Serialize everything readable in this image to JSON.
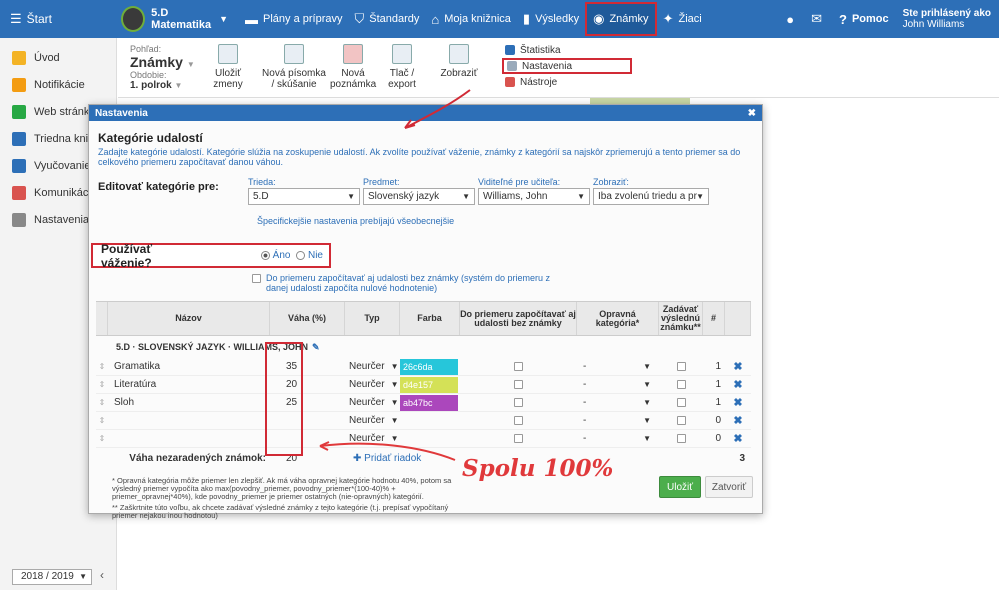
{
  "topbar": {
    "start": "Štart",
    "class_name": "5.D",
    "class_subject": "Matematika",
    "plans": "Plány a prípravy",
    "standards": "Štandardy",
    "library": "Moja knižnica",
    "results": "Výsledky",
    "grades": "Známky",
    "students": "Žiaci",
    "help": "Pomoc",
    "user_prefix": "Ste prihlásený ako",
    "user_name": "John Williams"
  },
  "sidebar": {
    "items": [
      {
        "label": "Úvod",
        "color": "#f3b325"
      },
      {
        "label": "Notifikácie",
        "color": "#f39c12"
      },
      {
        "label": "Web stránka",
        "color": "#27a844"
      },
      {
        "label": "Triedna kniha",
        "color": "#2d6fb7"
      },
      {
        "label": "Vyučovanie",
        "color": "#2d6fb7"
      },
      {
        "label": "Komunikácia",
        "color": "#d9534f"
      },
      {
        "label": "Nastavenia",
        "color": "#888888"
      }
    ],
    "year": "2018 / 2019"
  },
  "ribbon": {
    "view_label": "Pohľad:",
    "view_value": "Známky",
    "period_label": "Obdobie:",
    "period_value": "1. polrok",
    "save_changes": "Uložiť zmeny",
    "new_test": "Nová písomka / skúšanie",
    "new_note": "Nová poznámka",
    "print": "Tlač / export",
    "show": "Zobraziť",
    "menu_stats": "Štatistika",
    "menu_settings": "Nastavenia",
    "menu_tools": "Nástroje"
  },
  "modal": {
    "title": "Nastavenia",
    "section_title": "Kategórie udalostí",
    "section_desc": "Zadajte kategórie udalostí. Kategórie slúžia na zoskupenie udalostí. Ak zvolíte používať váženie, známky z kategórií sa najskôr zpriemerujú a tento priemer sa do celkového priemeru započítavať danou váhou.",
    "edit_label": "Editovať kategórie pre:",
    "filters": {
      "class_label": "Trieda:",
      "class_value": "5.D",
      "subject_label": "Predmet:",
      "subject_value": "Slovenský jazyk",
      "teacher_label": "Viditeľné pre učiteľa:",
      "teacher_value": "Williams, John",
      "show_label": "Zobraziť:",
      "show_value": "Iba zvolenú triedu a pr",
      "note": "Špecifickejšie nastavenia prebíjajú všeobecnejšie"
    },
    "weighting_question": "Používať váženie?",
    "opt_yes": "Áno",
    "opt_no": "Nie",
    "include_ungraded": "Do priemeru započítavať aj udalosti bez známky (systém do priemeru z danej udalosti započíta nulové hodnotenie)",
    "table": {
      "headers": {
        "name": "Názov",
        "weight": "Váha (%)",
        "type": "Typ",
        "color": "Farba",
        "include": "Do priemeru započítavať aj udalosti bez známky",
        "corrective": "Opravná kategória*",
        "final": "Zadávať výslednú známku**",
        "count": "#"
      },
      "group": "5.D · SLOVENSKÝ JAZYK · WILLIAMS, JOHN",
      "rows": [
        {
          "name": "Gramatika",
          "weight": "35",
          "type": "Neurčer",
          "color_code": "26c6da",
          "color": "#26c6da",
          "corrective": "-",
          "count": "1"
        },
        {
          "name": "Literatúra",
          "weight": "20",
          "type": "Neurčer",
          "color_code": "d4e157",
          "color": "#d4e157",
          "corrective": "-",
          "count": "1"
        },
        {
          "name": "Sloh",
          "weight": "25",
          "type": "Neurčer",
          "color_code": "ab47bc",
          "color": "#ab47bc",
          "corrective": "-",
          "count": "1"
        },
        {
          "name": "",
          "weight": "",
          "type": "Neurčer",
          "color_code": "",
          "color": "",
          "corrective": "-",
          "count": "0"
        },
        {
          "name": "",
          "weight": "",
          "type": "Neurčer",
          "color_code": "",
          "color": "",
          "corrective": "-",
          "count": "0"
        }
      ],
      "unassigned_label": "Váha nezaradených známok:",
      "unassigned_value": "20",
      "add_row": "Pridať riadok",
      "total_count": "3"
    },
    "note1": "* Opravná kategória môže priemer len zlepšiť. Ak má váha opravnej kategórie hodnotu 40%, potom sa výsledný priemer vypočíta ako max(povodny_priemer, povodny_priemer*(100-40)% + priemer_opravnej*40%), kde povodny_priemer je priemer ostatných (nie-opravných) kategórií.",
    "note2": "** Zaškrtnite túto voľbu, ak chcete zadávať výsledné známky z tejto kategórie (t.j. prepísať vypočítaný priemer nejakou inou hodnotou)",
    "save": "Uložiť",
    "close": "Zatvoriť"
  },
  "annotation": "Spolu 100%"
}
